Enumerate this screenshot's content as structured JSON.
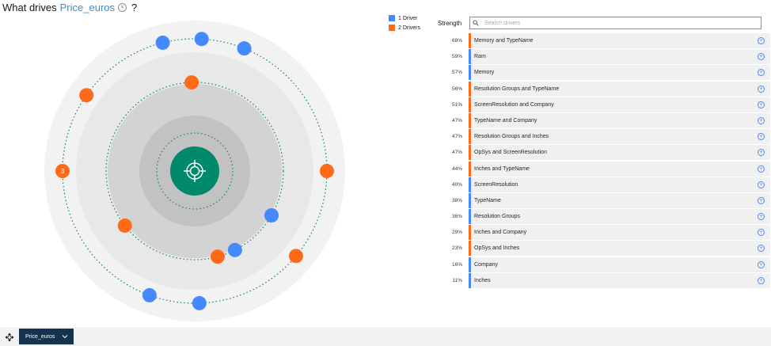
{
  "header": {
    "prefix": "What drives",
    "target": "Price_euros",
    "clear_glyph": "×",
    "suffix": "?"
  },
  "legend": [
    {
      "label": "1 Driver",
      "color": "#4589ff"
    },
    {
      "label": "2 Drivers",
      "color": "#ff6a1a"
    }
  ],
  "orbit": {
    "center_icon": "crosshair-target-icon",
    "cluster_label": "3",
    "nodes": [
      {
        "angle": -68,
        "ring": 3,
        "type": "1"
      },
      {
        "angle": -87,
        "ring": 3,
        "type": "1"
      },
      {
        "angle": -104,
        "ring": 3,
        "type": "1"
      },
      {
        "angle": -145,
        "ring": 3,
        "type": "2"
      },
      {
        "angle": 180,
        "ring": 3,
        "type": "2",
        "label": "3"
      },
      {
        "angle": 0,
        "ring": 3,
        "type": "2"
      },
      {
        "angle": 40,
        "ring": 3,
        "type": "2"
      },
      {
        "angle": 88,
        "ring": 3,
        "type": "1"
      },
      {
        "angle": 110,
        "ring": 3,
        "type": "1"
      },
      {
        "angle": -92,
        "ring": 2,
        "type": "2"
      },
      {
        "angle": 30,
        "ring": 2,
        "type": "1"
      },
      {
        "angle": 63,
        "ring": 2,
        "type": "1"
      },
      {
        "angle": 75,
        "ring": 2,
        "type": "2"
      },
      {
        "angle": 142,
        "ring": 2,
        "type": "2"
      }
    ]
  },
  "table": {
    "strength_label": "Strength",
    "search_placeholder": "Search drivers",
    "add_glyph": "+",
    "rows": [
      {
        "pct": "68%",
        "name": "Memory and TypeName",
        "type": "2"
      },
      {
        "pct": "59%",
        "name": "Ram",
        "type": "1"
      },
      {
        "pct": "57%",
        "name": "Memory",
        "type": "1"
      },
      {
        "pct": "56%",
        "name": "Resolution Groups and TypeName",
        "type": "2"
      },
      {
        "pct": "51%",
        "name": "ScreenResolution and Company",
        "type": "2"
      },
      {
        "pct": "47%",
        "name": "TypeName and Company",
        "type": "2"
      },
      {
        "pct": "47%",
        "name": "Resolution Groups and Inches",
        "type": "2"
      },
      {
        "pct": "47%",
        "name": "OpSys and ScreenResolution",
        "type": "2"
      },
      {
        "pct": "44%",
        "name": "Inches and TypeName",
        "type": "2"
      },
      {
        "pct": "40%",
        "name": "ScreenResolution",
        "type": "1"
      },
      {
        "pct": "38%",
        "name": "TypeName",
        "type": "1"
      },
      {
        "pct": "36%",
        "name": "Resolution Groups",
        "type": "1"
      },
      {
        "pct": "29%",
        "name": "Inches and Company",
        "type": "2"
      },
      {
        "pct": "23%",
        "name": "OpSys and Inches",
        "type": "2"
      },
      {
        "pct": "16%",
        "name": "Company",
        "type": "1"
      },
      {
        "pct": "11%",
        "name": "Inches",
        "type": "1"
      }
    ]
  },
  "footer": {
    "target_pill": "Price_euros",
    "menu_icon": "move-icon",
    "dropdown_icon": "chevron-down-icon"
  },
  "colors": {
    "one_driver": "#4589ff",
    "two_drivers": "#ff6a1a",
    "center": "#00896b",
    "pill": "#15334f"
  }
}
